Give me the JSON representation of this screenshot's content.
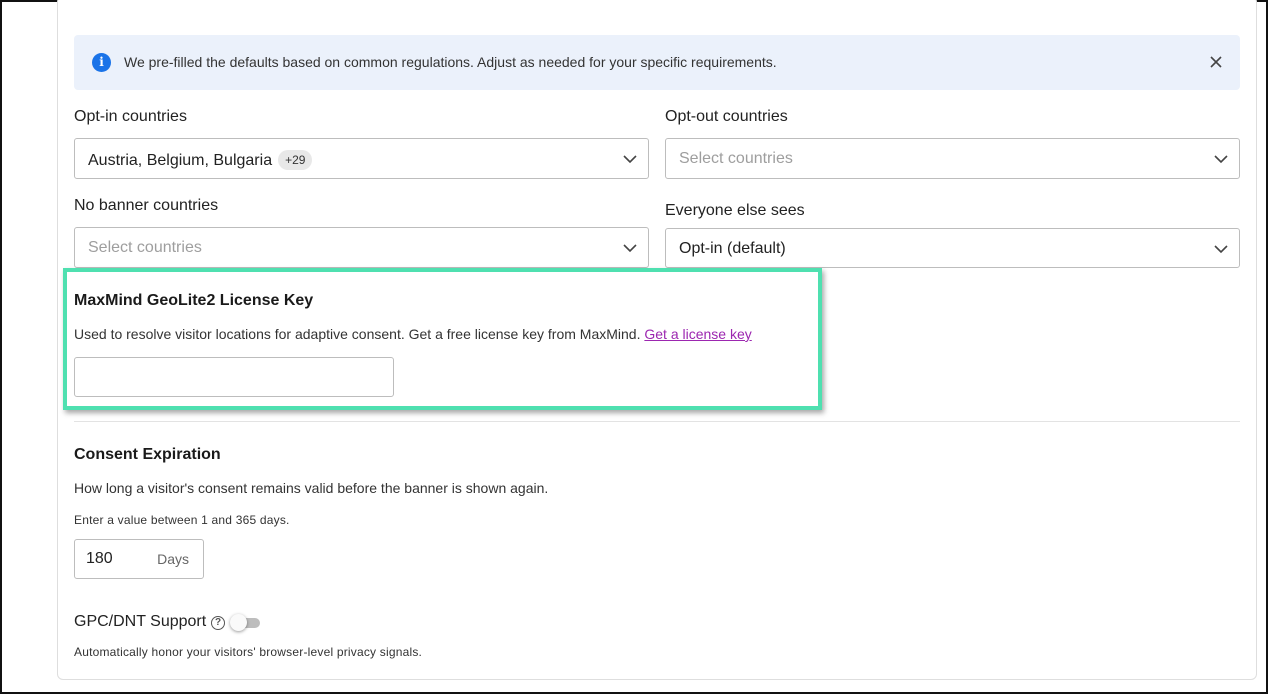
{
  "alert": {
    "text": "We pre-filled the defaults based on common regulations. Adjust as needed for your specific requirements."
  },
  "opt_in": {
    "label": "Opt-in countries",
    "value": "Austria, Belgium, Bulgaria",
    "extra_count": "+29"
  },
  "opt_out": {
    "label": "Opt-out countries",
    "placeholder": "Select countries"
  },
  "no_banner": {
    "label": "No banner countries",
    "placeholder": "Select countries"
  },
  "everyone_else": {
    "label": "Everyone else sees",
    "value": "Opt-in (default)"
  },
  "maxmind": {
    "title": "MaxMind GeoLite2 License Key",
    "description": "Used to resolve visitor locations for adaptive consent. Get a free license key from MaxMind.",
    "link_text": "Get a license key",
    "value": ""
  },
  "consent_expiration": {
    "title": "Consent Expiration",
    "description": "How long a visitor's consent remains valid before the banner is shown again.",
    "hint": "Enter a value between 1 and 365 days.",
    "value": "180",
    "unit": "Days"
  },
  "gpc": {
    "label": "GPC/DNT Support",
    "help": "?",
    "enabled": false,
    "description": "Automatically honor your visitors' browser-level privacy signals."
  },
  "colors": {
    "accent": "#1a73e8",
    "link": "#9c27b0",
    "highlight": "#4fe0b0",
    "alert_bg": "#ebf1fb"
  }
}
